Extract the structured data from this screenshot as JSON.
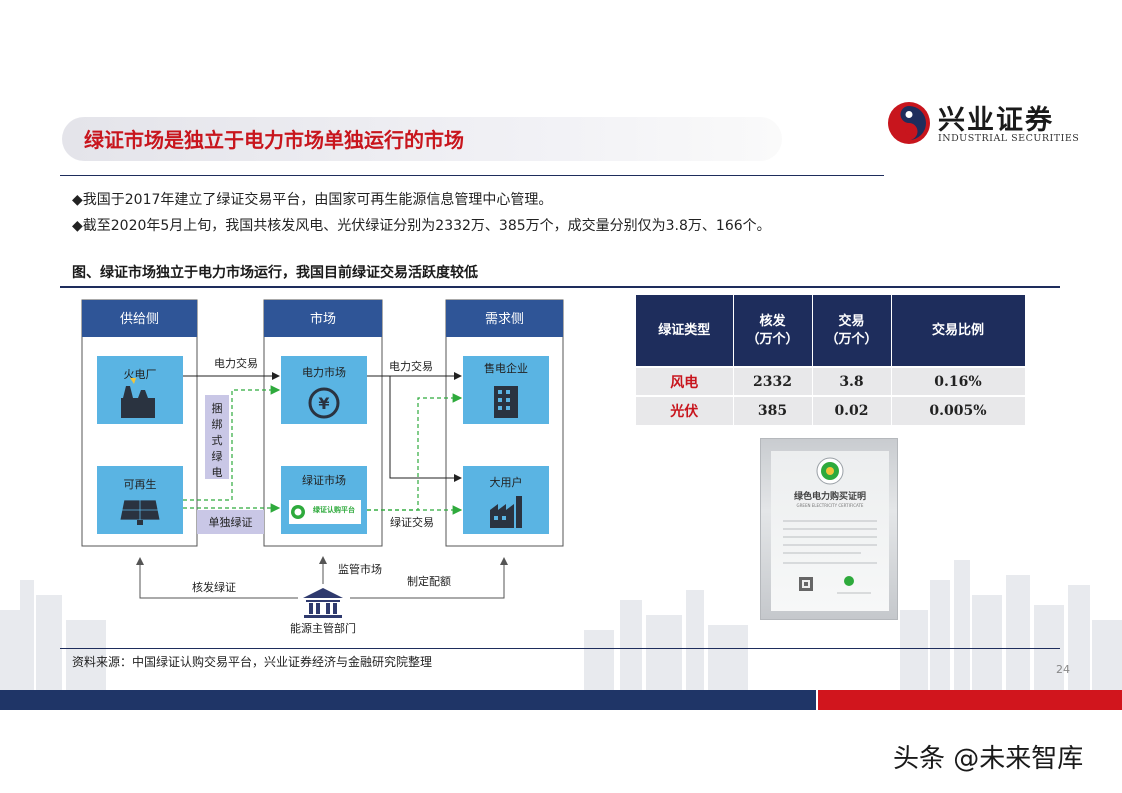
{
  "header": {
    "logo_name": "兴业证券",
    "logo_english": "INDUSTRIAL SECURITIES",
    "title": "绿证市场是独立于电力市场单独运行的市场"
  },
  "bullets": [
    "◆我国于2017年建立了绿证交易平台，由国家可再生能源信息管理中心管理。",
    "◆截至2020年5月上旬，我国共核发风电、光伏绿证分别为2332万、385万个，成交量分别仅为3.8万、166个。"
  ],
  "figure": {
    "title": "图、绿证市场独立于电力市场运行，我国目前绿证交易活跃度较低",
    "diagram": {
      "supply_header": "供给侧",
      "market_header": "市场",
      "demand_header": "需求侧",
      "thermal": "火电厂",
      "renewable": "可再生",
      "power_market": "电力市场",
      "cert_market": "绿证市场",
      "cert_platform_label": "绿证认购平台",
      "retailer": "售电企业",
      "large_user": "大用户",
      "power_trade_1": "电力交易",
      "power_trade_2": "电力交易",
      "bundled_line1": "捆",
      "bundled_line2": "绑",
      "bundled_line3": "式",
      "bundled_line4": "绿",
      "bundled_line5": "电",
      "separate_cert": "单独绿证",
      "cert_trade": "绿证交易",
      "issue_cert": "核发绿证",
      "supervise_market": "监管市场",
      "set_quota": "制定配额",
      "authority": "能源主管部门"
    },
    "table": {
      "headers": [
        [
          "绿证类型"
        ],
        [
          "核发",
          "（万个）"
        ],
        [
          "交易",
          "（万个）"
        ],
        [
          "交易比例"
        ]
      ],
      "rows": [
        [
          "风电",
          "2332",
          "3.8",
          "0.16%"
        ],
        [
          "光伏",
          "385",
          "0.02",
          "0.005%"
        ]
      ]
    },
    "certificate": {
      "title": "绿色电力购买证明",
      "subtitle": "GREEN ELECTRICITY CERTIFICATE"
    }
  },
  "source": "资料来源：中国绿证认购交易平台，兴业证券经济与金融研究院整理",
  "page_number": "24",
  "watermark": "头条 @未来智库",
  "colors": {
    "navy": "#1e2d5c",
    "red": "#c8151d",
    "box_blue": "#5ab4e3",
    "header_blue": "#2f5597",
    "green_arrow": "#2eaa3c",
    "lavender": "#c9c7e6"
  }
}
